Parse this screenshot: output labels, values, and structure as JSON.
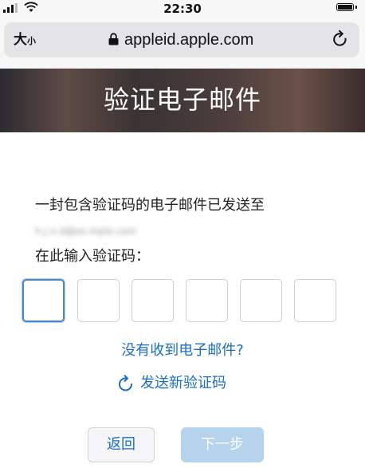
{
  "status_bar": {
    "time": "22:30"
  },
  "browser": {
    "text_size_big": "大",
    "text_size_small": "小",
    "url": "appleid.apple.com",
    "lock_icon": "lock-icon",
    "reload_icon": "reload-icon"
  },
  "banner": {
    "title": "验证电子邮件"
  },
  "content": {
    "intro": "一封包含验证码的电子邮件已发送至",
    "email_redacted": "h.j.n.d@ex.mple.com",
    "prompt": "在此输入验证码：",
    "code_boxes": [
      "",
      "",
      "",
      "",
      "",
      ""
    ],
    "no_email_link": "没有收到电子邮件?",
    "resend_label": "发送新验证码"
  },
  "buttons": {
    "back": "返回",
    "next": "下一步"
  },
  "colors": {
    "link": "#1a6fc4",
    "active_border": "#4f86c9",
    "next_disabled_bg": "#b6d3ee"
  }
}
